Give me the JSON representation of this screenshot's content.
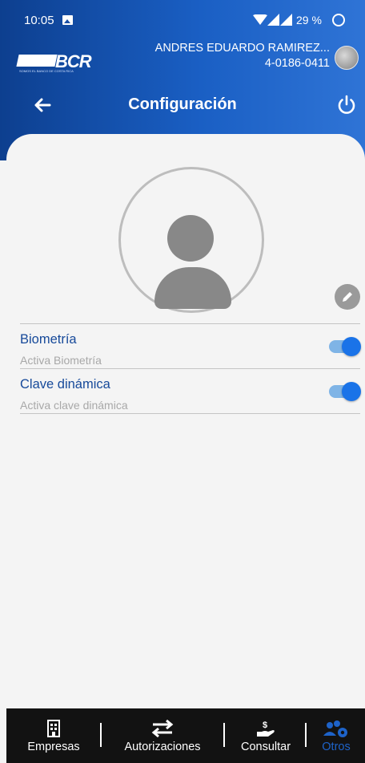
{
  "status_bar": {
    "time": "10:05",
    "battery": "29 %"
  },
  "header": {
    "logo_text": "BCR",
    "logo_tagline": "SOMOS EL BANCO DE COSTA RICA",
    "user_name": "ANDRES EDUARDO RAMIREZ...",
    "user_id": "4-0186-0411",
    "title": "Configuración"
  },
  "settings": [
    {
      "label": "Biometría",
      "sublabel": "Activa Biometría",
      "enabled": true
    },
    {
      "label": "Clave dinámica",
      "sublabel": "Activa clave dinámica",
      "enabled": true
    }
  ],
  "bottom_nav": [
    {
      "label": "Empresas",
      "icon": "building-icon",
      "active": false
    },
    {
      "label": "Autorizaciones",
      "icon": "swap-arrows-icon",
      "active": false
    },
    {
      "label": "Consultar",
      "icon": "hand-money-icon",
      "active": false
    },
    {
      "label": "Otros",
      "icon": "users-gear-icon",
      "active": true
    }
  ],
  "colors": {
    "header_start": "#0d3f8f",
    "header_end": "#2f74d6",
    "label_blue": "#174a9a",
    "toggle_on": "#1a73e8",
    "nav_active": "#1e63c9",
    "nav_background": "#121212"
  }
}
